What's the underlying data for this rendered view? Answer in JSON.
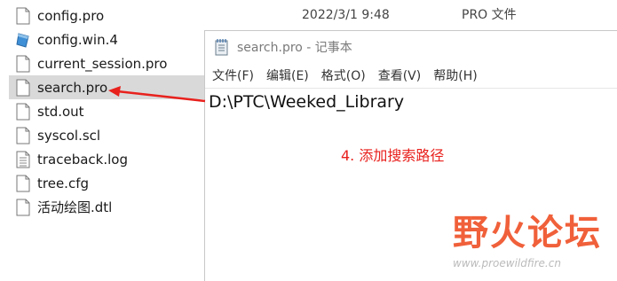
{
  "explorer": {
    "header_row": {
      "date": "2022/3/1 9:48",
      "type": "PRO 文件"
    },
    "files": [
      {
        "name": "config.pro",
        "icon": "document-icon"
      },
      {
        "name": "config.win.4",
        "icon": "win-config-icon"
      },
      {
        "name": "current_session.pro",
        "icon": "document-icon"
      },
      {
        "name": "search.pro",
        "icon": "document-icon",
        "selected": true
      },
      {
        "name": "std.out",
        "icon": "document-icon"
      },
      {
        "name": "syscol.scl",
        "icon": "document-icon"
      },
      {
        "name": "traceback.log",
        "icon": "text-document-icon"
      },
      {
        "name": "tree.cfg",
        "icon": "document-icon"
      },
      {
        "name": "活动绘图.dtl",
        "icon": "document-icon"
      }
    ]
  },
  "notepad": {
    "title": "search.pro - 记事本",
    "menu": [
      "文件(F)",
      "编辑(E)",
      "格式(O)",
      "查看(V)",
      "帮助(H)"
    ],
    "content": "D:\\PTC\\Weeked_Library",
    "annotation": "4. 添加搜索路径"
  },
  "watermark": {
    "title": "野火论坛",
    "url": "www.proewildfire.cn"
  },
  "colors": {
    "selection": "#d9d9d9",
    "annotation": "#e8211d",
    "watermark": "#f0603a"
  }
}
